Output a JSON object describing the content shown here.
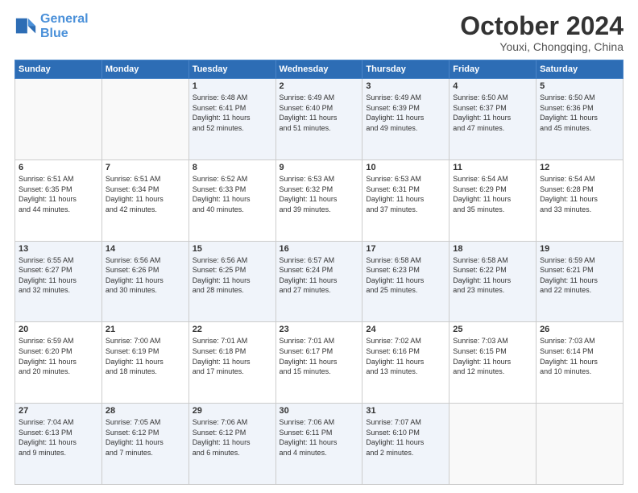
{
  "logo": {
    "line1": "General",
    "line2": "Blue"
  },
  "header": {
    "title": "October 2024",
    "subtitle": "Youxi, Chongqing, China"
  },
  "weekdays": [
    "Sunday",
    "Monday",
    "Tuesday",
    "Wednesday",
    "Thursday",
    "Friday",
    "Saturday"
  ],
  "weeks": [
    [
      {
        "day": "",
        "info": ""
      },
      {
        "day": "",
        "info": ""
      },
      {
        "day": "1",
        "info": "Sunrise: 6:48 AM\nSunset: 6:41 PM\nDaylight: 11 hours\nand 52 minutes."
      },
      {
        "day": "2",
        "info": "Sunrise: 6:49 AM\nSunset: 6:40 PM\nDaylight: 11 hours\nand 51 minutes."
      },
      {
        "day": "3",
        "info": "Sunrise: 6:49 AM\nSunset: 6:39 PM\nDaylight: 11 hours\nand 49 minutes."
      },
      {
        "day": "4",
        "info": "Sunrise: 6:50 AM\nSunset: 6:37 PM\nDaylight: 11 hours\nand 47 minutes."
      },
      {
        "day": "5",
        "info": "Sunrise: 6:50 AM\nSunset: 6:36 PM\nDaylight: 11 hours\nand 45 minutes."
      }
    ],
    [
      {
        "day": "6",
        "info": "Sunrise: 6:51 AM\nSunset: 6:35 PM\nDaylight: 11 hours\nand 44 minutes."
      },
      {
        "day": "7",
        "info": "Sunrise: 6:51 AM\nSunset: 6:34 PM\nDaylight: 11 hours\nand 42 minutes."
      },
      {
        "day": "8",
        "info": "Sunrise: 6:52 AM\nSunset: 6:33 PM\nDaylight: 11 hours\nand 40 minutes."
      },
      {
        "day": "9",
        "info": "Sunrise: 6:53 AM\nSunset: 6:32 PM\nDaylight: 11 hours\nand 39 minutes."
      },
      {
        "day": "10",
        "info": "Sunrise: 6:53 AM\nSunset: 6:31 PM\nDaylight: 11 hours\nand 37 minutes."
      },
      {
        "day": "11",
        "info": "Sunrise: 6:54 AM\nSunset: 6:29 PM\nDaylight: 11 hours\nand 35 minutes."
      },
      {
        "day": "12",
        "info": "Sunrise: 6:54 AM\nSunset: 6:28 PM\nDaylight: 11 hours\nand 33 minutes."
      }
    ],
    [
      {
        "day": "13",
        "info": "Sunrise: 6:55 AM\nSunset: 6:27 PM\nDaylight: 11 hours\nand 32 minutes."
      },
      {
        "day": "14",
        "info": "Sunrise: 6:56 AM\nSunset: 6:26 PM\nDaylight: 11 hours\nand 30 minutes."
      },
      {
        "day": "15",
        "info": "Sunrise: 6:56 AM\nSunset: 6:25 PM\nDaylight: 11 hours\nand 28 minutes."
      },
      {
        "day": "16",
        "info": "Sunrise: 6:57 AM\nSunset: 6:24 PM\nDaylight: 11 hours\nand 27 minutes."
      },
      {
        "day": "17",
        "info": "Sunrise: 6:58 AM\nSunset: 6:23 PM\nDaylight: 11 hours\nand 25 minutes."
      },
      {
        "day": "18",
        "info": "Sunrise: 6:58 AM\nSunset: 6:22 PM\nDaylight: 11 hours\nand 23 minutes."
      },
      {
        "day": "19",
        "info": "Sunrise: 6:59 AM\nSunset: 6:21 PM\nDaylight: 11 hours\nand 22 minutes."
      }
    ],
    [
      {
        "day": "20",
        "info": "Sunrise: 6:59 AM\nSunset: 6:20 PM\nDaylight: 11 hours\nand 20 minutes."
      },
      {
        "day": "21",
        "info": "Sunrise: 7:00 AM\nSunset: 6:19 PM\nDaylight: 11 hours\nand 18 minutes."
      },
      {
        "day": "22",
        "info": "Sunrise: 7:01 AM\nSunset: 6:18 PM\nDaylight: 11 hours\nand 17 minutes."
      },
      {
        "day": "23",
        "info": "Sunrise: 7:01 AM\nSunset: 6:17 PM\nDaylight: 11 hours\nand 15 minutes."
      },
      {
        "day": "24",
        "info": "Sunrise: 7:02 AM\nSunset: 6:16 PM\nDaylight: 11 hours\nand 13 minutes."
      },
      {
        "day": "25",
        "info": "Sunrise: 7:03 AM\nSunset: 6:15 PM\nDaylight: 11 hours\nand 12 minutes."
      },
      {
        "day": "26",
        "info": "Sunrise: 7:03 AM\nSunset: 6:14 PM\nDaylight: 11 hours\nand 10 minutes."
      }
    ],
    [
      {
        "day": "27",
        "info": "Sunrise: 7:04 AM\nSunset: 6:13 PM\nDaylight: 11 hours\nand 9 minutes."
      },
      {
        "day": "28",
        "info": "Sunrise: 7:05 AM\nSunset: 6:12 PM\nDaylight: 11 hours\nand 7 minutes."
      },
      {
        "day": "29",
        "info": "Sunrise: 7:06 AM\nSunset: 6:12 PM\nDaylight: 11 hours\nand 6 minutes."
      },
      {
        "day": "30",
        "info": "Sunrise: 7:06 AM\nSunset: 6:11 PM\nDaylight: 11 hours\nand 4 minutes."
      },
      {
        "day": "31",
        "info": "Sunrise: 7:07 AM\nSunset: 6:10 PM\nDaylight: 11 hours\nand 2 minutes."
      },
      {
        "day": "",
        "info": ""
      },
      {
        "day": "",
        "info": ""
      }
    ]
  ]
}
